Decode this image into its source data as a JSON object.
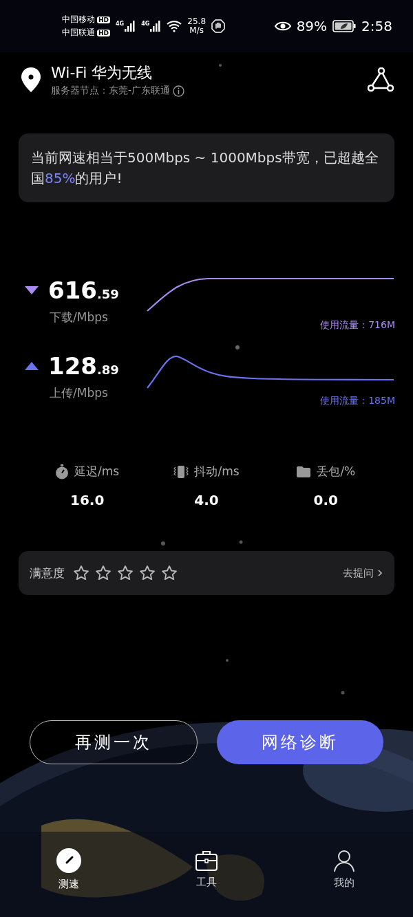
{
  "status_bar": {
    "carriers": [
      {
        "name": "中国移动",
        "badge": "HD"
      },
      {
        "name": "中国联通",
        "badge": "HD"
      }
    ],
    "networks": [
      "4G",
      "4G"
    ],
    "speed_value": "25.8",
    "speed_unit": "M/s",
    "battery": "89%",
    "time": "2:58"
  },
  "header": {
    "title": "Wi-Fi 华为无线",
    "subtitle": "服务器节点：东莞-广东联通"
  },
  "summary": {
    "before": "当前网速相当于500Mbps ~ 1000Mbps带宽，已超越全国",
    "highlight": "85%",
    "after": "的用户!"
  },
  "speeds": [
    {
      "kind": "download",
      "integer": "616",
      "decimal": ".59",
      "label": "下载/Mbps",
      "usage": "使用流量：716M",
      "color": "#a98cf0"
    },
    {
      "kind": "upload",
      "integer": "128",
      "decimal": ".89",
      "label": "上传/Mbps",
      "usage": "使用流量：185M",
      "color": "#6a72f0"
    }
  ],
  "stats": [
    {
      "kind": "latency",
      "label": "延迟/ms",
      "value": "16.0"
    },
    {
      "kind": "jitter",
      "label": "抖动/ms",
      "value": "4.0"
    },
    {
      "kind": "loss",
      "label": "丢包/%",
      "value": "0.0"
    }
  ],
  "rating": {
    "label": "满意度",
    "stars": 0,
    "link": "去提问"
  },
  "buttons": [
    {
      "kind": "outline",
      "label": "再测一次"
    },
    {
      "kind": "primary",
      "label": "网络诊断"
    }
  ],
  "nav": [
    {
      "kind": "speed",
      "label": "测速",
      "selected": true
    },
    {
      "kind": "tools",
      "label": "工具",
      "selected": false
    },
    {
      "kind": "me",
      "label": "我的",
      "selected": false
    }
  ]
}
